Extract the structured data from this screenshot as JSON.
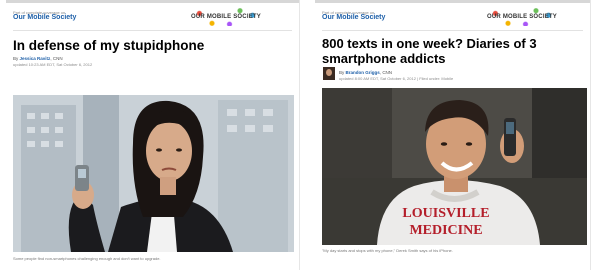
{
  "left_article": {
    "coverage_note": "Part of complete coverage on",
    "section": "Our Mobile Society",
    "logo_text": "OUR MOBILE SOCIETY",
    "headline": "In defense of my stupidphone",
    "byline_prefix": "By",
    "author": "Jessica Ravitz",
    "outlet": "CNN",
    "timestamp": "updated 10:23 AM EDT, Sat October 6, 2012",
    "caption": "Some people find non-smartphones challenging enough and don't want to upgrade."
  },
  "right_article": {
    "coverage_note": "Part of complete coverage on",
    "section": "Our Mobile Society",
    "logo_text": "OUR MOBILE SOCIETY",
    "headline": "800 texts in one week? Diaries of 3 smartphone addicts",
    "byline_prefix": "By",
    "author": "Brandon Griggs",
    "outlet": "CNN",
    "timestamp": "updated 8:00 AM EDT, Sat October 6, 2012 | Filed under: Mobile",
    "caption": "\"My day starts and stops with my phone,\" Derek Smith says of his iPhone.",
    "sweatshirt_text": [
      "LOUISVILLE",
      "MEDICINE"
    ]
  },
  "colors": {
    "link": "#1d5fa8",
    "headline": "#000000",
    "sweatshirt_text": "#b41e2a"
  }
}
